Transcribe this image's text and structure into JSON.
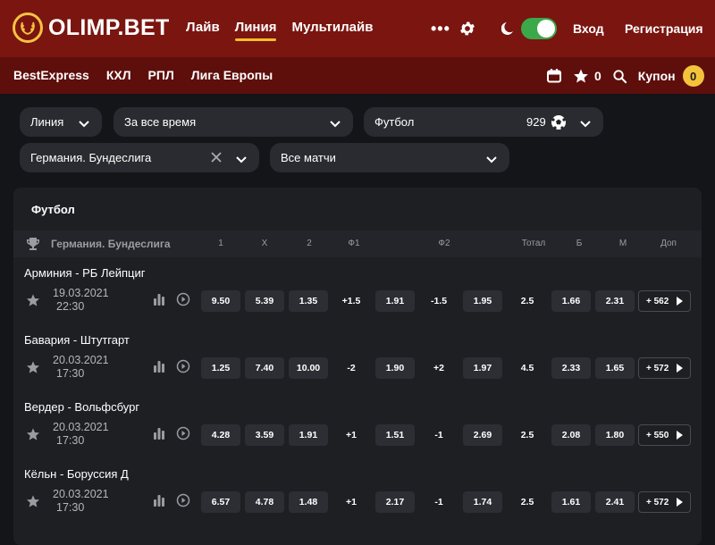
{
  "brand": {
    "name": "OLIMP.BET"
  },
  "nav": [
    "Лайв",
    "Линия",
    "Мультилайв"
  ],
  "header": {
    "more": "•••",
    "login": "Вход",
    "register": "Регистрация"
  },
  "subnav": [
    "BestExpress",
    "КХЛ",
    "РПЛ",
    "Лига Европы"
  ],
  "subbar": {
    "favorites_count": "0",
    "coupon_label": "Купон",
    "coupon_count": "0"
  },
  "filters": {
    "mode": "Линия",
    "period": "За все время",
    "sport": "Футбол",
    "sport_count": "929",
    "league": "Германия. Бундеслига",
    "matches": "Все матчи"
  },
  "panel": {
    "title": "Футбол",
    "league": "Германия. Бундеслига",
    "columns": [
      "1",
      "X",
      "2",
      "Ф1",
      "Ф2",
      "Тотал",
      "Б",
      "М",
      "Доп"
    ]
  },
  "matches": [
    {
      "teams": "Арминия - РБ Лейпциг",
      "date": "19.03.2021",
      "time": "22:30",
      "w1": "9.50",
      "x": "5.39",
      "w2": "1.35",
      "h1": "+1.5",
      "h1_odd": "1.91",
      "h2": "-1.5",
      "h2_odd": "1.95",
      "total": "2.5",
      "over": "1.66",
      "under": "2.31",
      "more": "+ 562"
    },
    {
      "teams": "Бавария - Штутгарт",
      "date": "20.03.2021",
      "time": "17:30",
      "w1": "1.25",
      "x": "7.40",
      "w2": "10.00",
      "h1": "-2",
      "h1_odd": "1.90",
      "h2": "+2",
      "h2_odd": "1.97",
      "total": "4.5",
      "over": "2.33",
      "under": "1.65",
      "more": "+ 572"
    },
    {
      "teams": "Вердер - Вольфсбург",
      "date": "20.03.2021",
      "time": "17:30",
      "w1": "4.28",
      "x": "3.59",
      "w2": "1.91",
      "h1": "+1",
      "h1_odd": "1.51",
      "h2": "-1",
      "h2_odd": "2.69",
      "total": "2.5",
      "over": "2.08",
      "under": "1.80",
      "more": "+ 550"
    },
    {
      "teams": "Кёльн - Боруссия Д",
      "date": "20.03.2021",
      "time": "17:30",
      "w1": "6.57",
      "x": "4.78",
      "w2": "1.48",
      "h1": "+1",
      "h1_odd": "2.17",
      "h2": "-1",
      "h2_odd": "1.74",
      "total": "2.5",
      "over": "1.61",
      "under": "2.41",
      "more": "+ 572"
    }
  ],
  "colors": {
    "header_bg": "#7a1510",
    "subbar_bg": "#5e0f0b",
    "accent": "#f5bd2a",
    "toggle_on": "#3ba84a",
    "page_bg": "#141518"
  }
}
